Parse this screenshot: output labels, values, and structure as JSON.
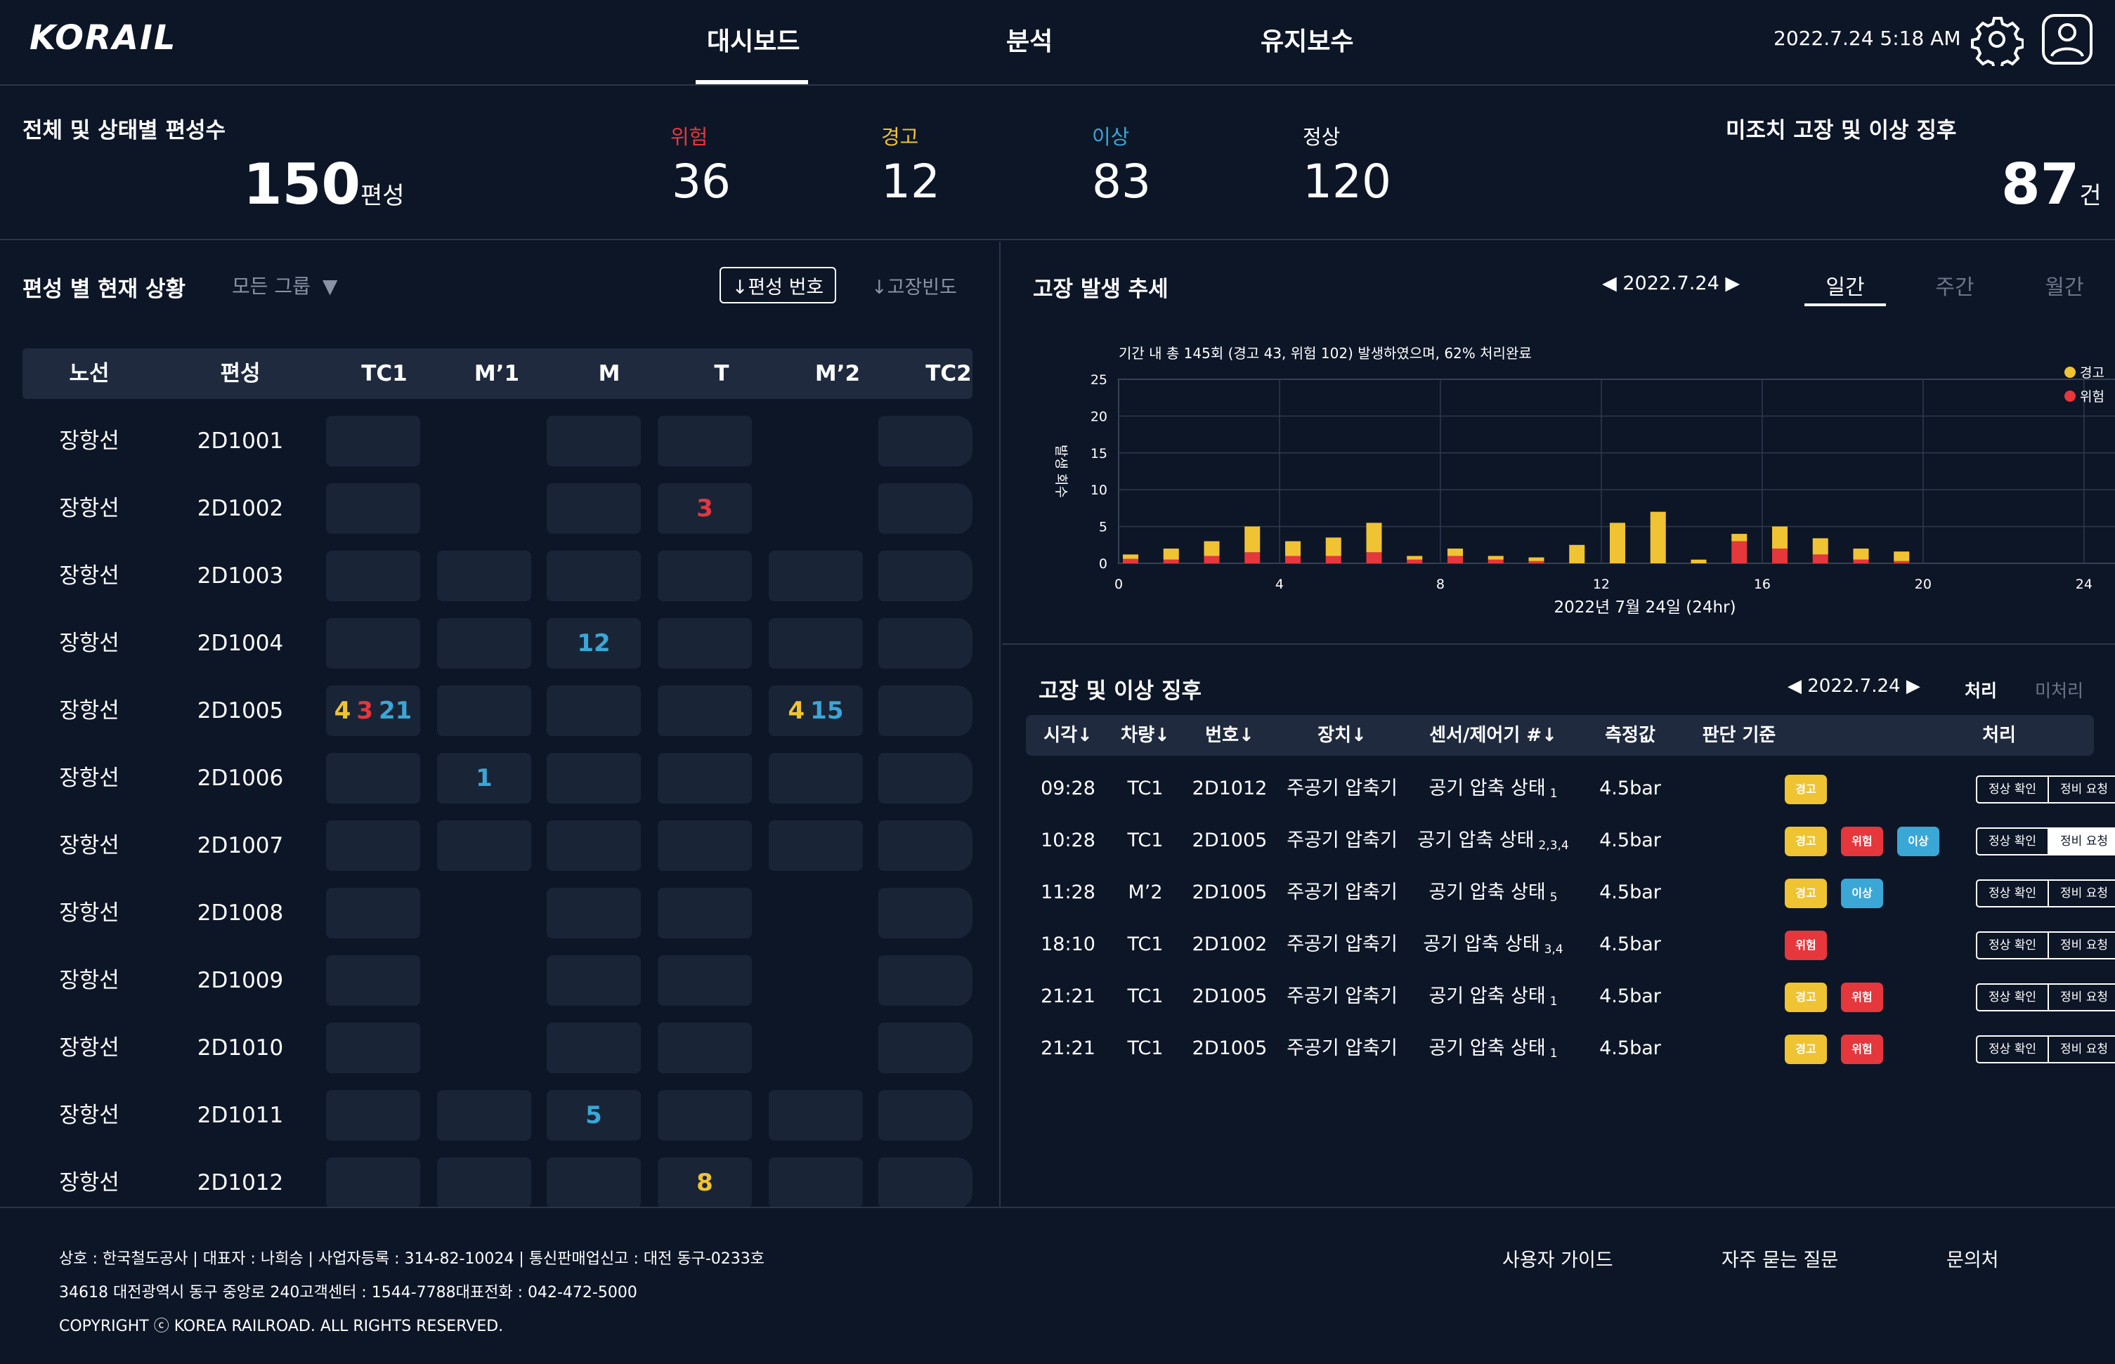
{
  "header": {
    "logo": "KORAIL",
    "nav": [
      "대시보드",
      "분석",
      "유지보수"
    ],
    "active_nav": "대시보드",
    "datetime": "2022.7.24 5:18 AM",
    "icons": [
      "gear-icon",
      "user-icon"
    ]
  },
  "summary": {
    "title": "전체 및 상태별 편성수",
    "total": "150",
    "total_unit": "편성",
    "stats": [
      {
        "label": "위험",
        "value": "36",
        "color": "#e5373c"
      },
      {
        "label": "경고",
        "value": "12",
        "color": "#f0c332"
      },
      {
        "label": "이상",
        "value": "83",
        "color": "#3aa7d6"
      },
      {
        "label": "정상",
        "value": "120",
        "color": "#ffffff"
      }
    ],
    "unresolved_title": "미조치 고장 및 이상 징후",
    "unresolved_value": "87",
    "unresolved_unit": "건"
  },
  "status_panel": {
    "title": "편성 별 현재 상황",
    "group_filter": "모든 그룹",
    "sort_number": "↓편성 번호",
    "sort_freq": "↓고장빈도",
    "columns": [
      "노선",
      "편성",
      "TC1",
      "M’1",
      "M",
      "T",
      "M’2",
      "TC2"
    ],
    "rows": [
      {
        "route": "장항선",
        "set": "2D1001",
        "cars": [
          [],
          null,
          [],
          [],
          null,
          []
        ]
      },
      {
        "route": "장항선",
        "set": "2D1002",
        "cars": [
          [],
          null,
          [],
          [
            {
              "v": "3",
              "c": "danger"
            }
          ],
          null,
          []
        ]
      },
      {
        "route": "장항선",
        "set": "2D1003",
        "cars": [
          [],
          [],
          [],
          [],
          [],
          []
        ]
      },
      {
        "route": "장항선",
        "set": "2D1004",
        "cars": [
          [],
          [],
          [
            {
              "v": "12",
              "c": "abnormal"
            }
          ],
          [],
          [],
          []
        ]
      },
      {
        "route": "장항선",
        "set": "2D1005",
        "cars": [
          [
            {
              "v": "4",
              "c": "warn"
            },
            {
              "v": "3",
              "c": "danger"
            },
            {
              "v": "21",
              "c": "abnormal"
            }
          ],
          [],
          [],
          [],
          [
            {
              "v": "4",
              "c": "warn"
            },
            {
              "v": "15",
              "c": "abnormal"
            }
          ],
          []
        ]
      },
      {
        "route": "장항선",
        "set": "2D1006",
        "cars": [
          [],
          [
            {
              "v": "1",
              "c": "abnormal"
            }
          ],
          [],
          [],
          [],
          []
        ]
      },
      {
        "route": "장항선",
        "set": "2D1007",
        "cars": [
          [],
          [],
          [],
          [],
          [],
          []
        ]
      },
      {
        "route": "장항선",
        "set": "2D1008",
        "cars": [
          [],
          null,
          [],
          [],
          null,
          []
        ]
      },
      {
        "route": "장항선",
        "set": "2D1009",
        "cars": [
          [],
          null,
          [],
          [],
          null,
          []
        ]
      },
      {
        "route": "장항선",
        "set": "2D1010",
        "cars": [
          [],
          null,
          [],
          [],
          null,
          []
        ]
      },
      {
        "route": "장항선",
        "set": "2D1011",
        "cars": [
          [],
          [],
          [
            {
              "v": "5",
              "c": "abnormal"
            }
          ],
          [],
          [],
          []
        ]
      },
      {
        "route": "장항선",
        "set": "2D1012",
        "cars": [
          [],
          [],
          [],
          [
            {
              "v": "8",
              "c": "warn"
            }
          ],
          [],
          []
        ]
      }
    ]
  },
  "trend_panel": {
    "title": "고장 발생 추세",
    "date": "2022.7.24",
    "tabs": [
      "일간",
      "주간",
      "월간"
    ],
    "active_tab": "일간"
  },
  "chart_data": {
    "type": "bar",
    "stacked": true,
    "title": "기간 내 총 145회 (경고 43, 위험 102) 발생하였으며, 62% 처리완료",
    "xlabel": "2022년 7월 24일 (24hr)",
    "ylabel": "발생 회수",
    "x": [
      0,
      1,
      2,
      3,
      4,
      5,
      6,
      7,
      8,
      9,
      10,
      11,
      12,
      13,
      14,
      15,
      16,
      17,
      18,
      19,
      20,
      21,
      22,
      23,
      24,
      25,
      26,
      27
    ],
    "xticks": [
      "0",
      "4",
      "8",
      "12",
      "16",
      "20",
      "24",
      "4"
    ],
    "ylim": [
      0,
      25
    ],
    "yticks": [
      0,
      5,
      10,
      15,
      20,
      25
    ],
    "grid": true,
    "legend_position": "top-right",
    "series": [
      {
        "name": "위험",
        "color": "#e5373c",
        "values": [
          0.6,
          0.5,
          1,
          1.5,
          1,
          1,
          1.5,
          0.5,
          1,
          0.5,
          0.3,
          0,
          0,
          0,
          0,
          3,
          2,
          1.2,
          0.5,
          0.3,
          0,
          0,
          0,
          0,
          0,
          0,
          0,
          0
        ]
      },
      {
        "name": "경고",
        "color": "#f0c332",
        "values": [
          0.6,
          1.5,
          2,
          3.5,
          2,
          2.5,
          4,
          0.5,
          1,
          0.5,
          0.5,
          2.5,
          5.5,
          7,
          0.5,
          1,
          3,
          2.2,
          1.5,
          1.3,
          0,
          0,
          0,
          0,
          0,
          0,
          0,
          0
        ]
      }
    ],
    "bar_positions": [
      0,
      1,
      2,
      3,
      4,
      5,
      6,
      7,
      8,
      9,
      10,
      11,
      12,
      13,
      14,
      15,
      16,
      17,
      18,
      19
    ]
  },
  "issues_panel": {
    "title": "고장 및 이상 징후",
    "date": "2022.7.24",
    "filters": [
      "처리",
      "미처리"
    ],
    "columns": [
      "시각↓",
      "차량↓",
      "번호↓",
      "장치↓",
      "센서/제어기 #↓",
      "측정값",
      "판단 기준",
      "처리"
    ],
    "actions": [
      "정상 확인",
      "정비 요청"
    ],
    "rows": [
      {
        "time": "09:28",
        "car": "TC1",
        "set": "2D1012",
        "device": "주공기 압축기",
        "sensor": "공기 압축 상태",
        "sensor_no": "1",
        "value": "4.5bar",
        "badges": [
          "경고"
        ]
      },
      {
        "time": "10:28",
        "car": "TC1",
        "set": "2D1005",
        "device": "주공기 압축기",
        "sensor": "공기 압축 상태",
        "sensor_no": "2,3,4",
        "value": "4.5bar",
        "badges": [
          "경고",
          "위험",
          "이상"
        ]
      },
      {
        "time": "11:28",
        "car": "M’2",
        "set": "2D1005",
        "device": "주공기 압축기",
        "sensor": "공기 압축 상태",
        "sensor_no": "5",
        "value": "4.5bar",
        "badges": [
          "경고",
          "이상"
        ]
      },
      {
        "time": "18:10",
        "car": "TC1",
        "set": "2D1002",
        "device": "주공기 압축기",
        "sensor": "공기 압축 상태",
        "sensor_no": "3,4",
        "value": "4.5bar",
        "badges": [
          "위험"
        ]
      },
      {
        "time": "21:21",
        "car": "TC1",
        "set": "2D1005",
        "device": "주공기 압축기",
        "sensor": "공기 압축 상태",
        "sensor_no": "1",
        "value": "4.5bar",
        "badges": [
          "경고",
          "위험"
        ]
      },
      {
        "time": "21:21",
        "car": "TC1",
        "set": "2D1005",
        "device": "주공기 압축기",
        "sensor": "공기 압축 상태",
        "sensor_no": "1",
        "value": "4.5bar",
        "badges": [
          "경고",
          "위험"
        ]
      }
    ]
  },
  "footer": {
    "line1": "상호 : 한국철도공사   |   대표자 : 나희승   |   사업자등록 : 314-82-10024   |   통신판매업신고 : 대전 동구-0233호",
    "line2": "34618 대전광역시 동구 중앙로 240고객센터 : 1544-7788대표전화 : 042-472-5000",
    "line3": "COPYRIGHT ⓒ KOREA RAILROAD. ALL RIGHTS RESERVED.",
    "links": [
      "사용자 가이드",
      "자주 묻는 질문",
      "문의처"
    ]
  },
  "colors": {
    "background": "#0d1627",
    "danger": "#e5373c",
    "warn": "#f0c332",
    "abnormal": "#3aa7d6"
  }
}
